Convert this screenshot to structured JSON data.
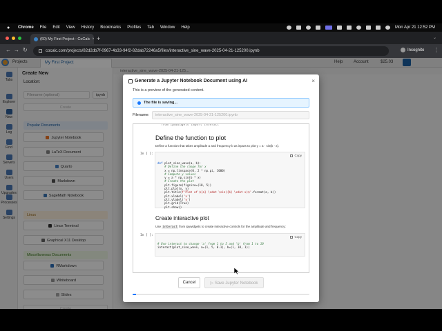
{
  "menubar": {
    "app": "Chrome",
    "items": [
      "File",
      "Edit",
      "View",
      "History",
      "Bookmarks",
      "Profiles",
      "Tab",
      "Window",
      "Help"
    ],
    "clock": "Mon Apr 21  12:52 PM"
  },
  "browser": {
    "tab_title": "(60) My First Project - CoCalc",
    "url": "cocalc.com/projects/82d2db7f-0967-4b33-94f2-82dab72246a5/files/interactive_sine_wave-2025-04-21-125200.ipynb",
    "incognito_label": "Incognito"
  },
  "cocalc": {
    "projects_label": "Projects",
    "project_tab": "My First Project",
    "help_label": "Help",
    "account_label": "Account",
    "balance": "$25.03",
    "rail": [
      "Tabs",
      "Explorer",
      "New",
      "Log",
      "Find",
      "Servers",
      "Users",
      "Upgrades",
      "Processes",
      "Settings"
    ],
    "flyout": {
      "title": "Create New",
      "location_label": "Location:",
      "filename_placeholder": "Filename (optional)",
      "ext": "ipynb",
      "create_label": "Create",
      "popular_label": "Popular Documents",
      "popular": [
        "Jupyter Notebook",
        "LaTeX Document",
        "Quarto",
        "Markdown",
        "SageMath Notebook"
      ],
      "linux_label": "Linux",
      "linux": [
        "Linux Terminal",
        "Graphical X11 Desktop"
      ],
      "misc_label": "Miscellaneous Documents",
      "misc": [
        "RMarkdown",
        "Whiteboard",
        "Slides"
      ]
    },
    "editor_tab": "interactive_sine_wave-2025-04-21-125..."
  },
  "modal": {
    "title": "Generate a Jupyter Notebook Document using AI",
    "subtitle": "This is a preview of the generated content.",
    "saving": "The file is saving...",
    "filename_label": "Filename:",
    "filename_value": "interactive_sine_wave-2025-04-21-125200.ipynb",
    "preview": {
      "cut_line": "from ipywidgets import interact",
      "heading1": "Define the function to plot",
      "para1": "Define a function that takes amplitude a and frequency b as inputs to plot y = a · sin(b · x).",
      "in_label": "In [ ]:",
      "copy_label": "Copy",
      "heading2": "Create interactive plot",
      "para2_pre": "Use",
      "para2_code": "interact",
      "para2_post": "from ipywidgets to create interactive controls for the amplitude and frequency:"
    },
    "cancel_label": "Cancel",
    "save_label": "Save Jupyter Notebook",
    "progress": 0.02
  }
}
